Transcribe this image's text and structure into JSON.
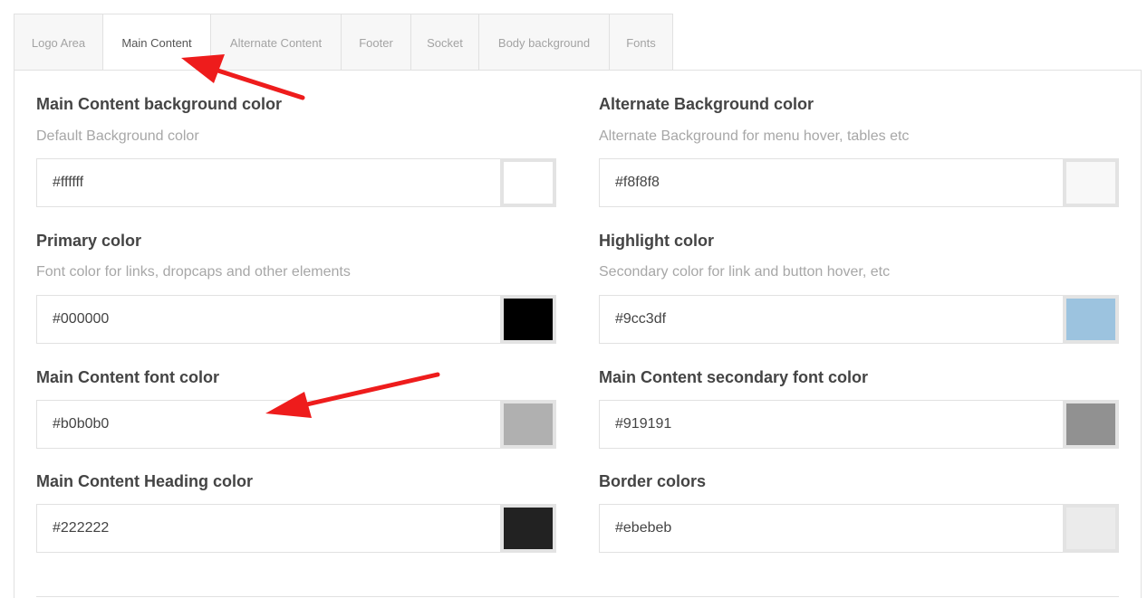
{
  "tabs": [
    {
      "label": "Logo Area",
      "active": false
    },
    {
      "label": "Main Content",
      "active": true
    },
    {
      "label": "Alternate Content",
      "active": false
    },
    {
      "label": "Footer",
      "active": false
    },
    {
      "label": "Socket",
      "active": false
    },
    {
      "label": "Body background",
      "active": false
    },
    {
      "label": "Fonts",
      "active": false
    }
  ],
  "fields": {
    "main_bg": {
      "title": "Main Content background color",
      "desc": "Default Background color",
      "value": "#ffffff",
      "swatch": "#ffffff"
    },
    "alt_bg": {
      "title": "Alternate Background color",
      "desc": "Alternate Background for menu hover, tables etc",
      "value": "#f8f8f8",
      "swatch": "#f8f8f8"
    },
    "primary": {
      "title": "Primary color",
      "desc": "Font color for links, dropcaps and other elements",
      "value": "#000000",
      "swatch": "#000000"
    },
    "highlight": {
      "title": "Highlight color",
      "desc": "Secondary color for link and button hover, etc",
      "value": "#9cc3df",
      "swatch": "#9cc3df"
    },
    "font_color": {
      "title": "Main Content font color",
      "value": "#b0b0b0",
      "swatch": "#b0b0b0"
    },
    "secondary_font": {
      "title": "Main Content secondary font color",
      "value": "#919191",
      "swatch": "#919191"
    },
    "heading": {
      "title": "Main Content Heading color",
      "value": "#222222",
      "swatch": "#222222"
    },
    "border": {
      "title": "Border colors",
      "value": "#ebebeb",
      "swatch": "#ebebeb"
    }
  },
  "annotation_color": "#ee1c1c"
}
